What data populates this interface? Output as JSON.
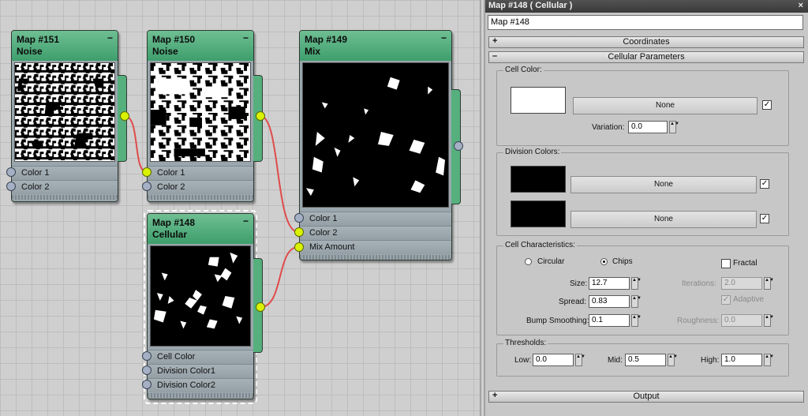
{
  "graph": {
    "nodes": [
      {
        "id": "151",
        "title": "Map #151",
        "type": "Noise",
        "ports": [
          "Color 1",
          "Color 2"
        ]
      },
      {
        "id": "150",
        "title": "Map #150",
        "type": "Noise",
        "ports": [
          "Color 1",
          "Color 2"
        ]
      },
      {
        "id": "149",
        "title": "Map #149",
        "type": "Mix",
        "ports": [
          "Color 1",
          "Color 2",
          "Mix Amount"
        ]
      },
      {
        "id": "148",
        "title": "Map #148",
        "type": "Cellular",
        "ports": [
          "Cell Color",
          "Division Color1",
          "Division Color2"
        ]
      }
    ],
    "minimize_glyph": "−",
    "wire_color": "#e04b4b",
    "socket_active_color": "#d9f200",
    "header_color": "#4fae7c"
  },
  "panel": {
    "title": "Map #148  ( Cellular )",
    "close_glyph": "×",
    "map_name": "Map #148",
    "rollouts": {
      "coordinates": {
        "label": "Coordinates",
        "sign": "+"
      },
      "cellular": {
        "label": "Cellular Parameters",
        "sign": "–"
      },
      "output": {
        "label": "Output",
        "sign": "+"
      }
    },
    "cell_color": {
      "group_label": "Cell Color:",
      "swatch_color": "#ffffff",
      "map_button": "None",
      "checked": "✓",
      "variation_label": "Variation:",
      "variation_value": "0.0"
    },
    "division_colors": {
      "group_label": "Division Colors:",
      "rows": [
        {
          "swatch_color": "#000000",
          "map_button": "None",
          "checked": "✓"
        },
        {
          "swatch_color": "#000000",
          "map_button": "None",
          "checked": "✓"
        }
      ]
    },
    "characteristics": {
      "group_label": "Cell Characteristics:",
      "circular_label": "Circular",
      "chips_label": "Chips",
      "selected": "Chips",
      "fractal_label": "Fractal",
      "fractal_checked": "",
      "size_label": "Size:",
      "size_value": "12.7",
      "spread_label": "Spread:",
      "spread_value": "0.83",
      "bump_label": "Bump Smoothing:",
      "bump_value": "0.1",
      "iterations_label": "Iterations:",
      "iterations_value": "2.0",
      "adaptive_label": "Adaptive",
      "adaptive_checked": "✓",
      "roughness_label": "Roughness:",
      "roughness_value": "0.0"
    },
    "thresholds": {
      "group_label": "Thresholds:",
      "low_label": "Low:",
      "low_value": "0.0",
      "mid_label": "Mid:",
      "mid_value": "0.5",
      "high_label": "High:",
      "high_value": "1.0"
    },
    "spinner_glyph": "▲▼"
  }
}
